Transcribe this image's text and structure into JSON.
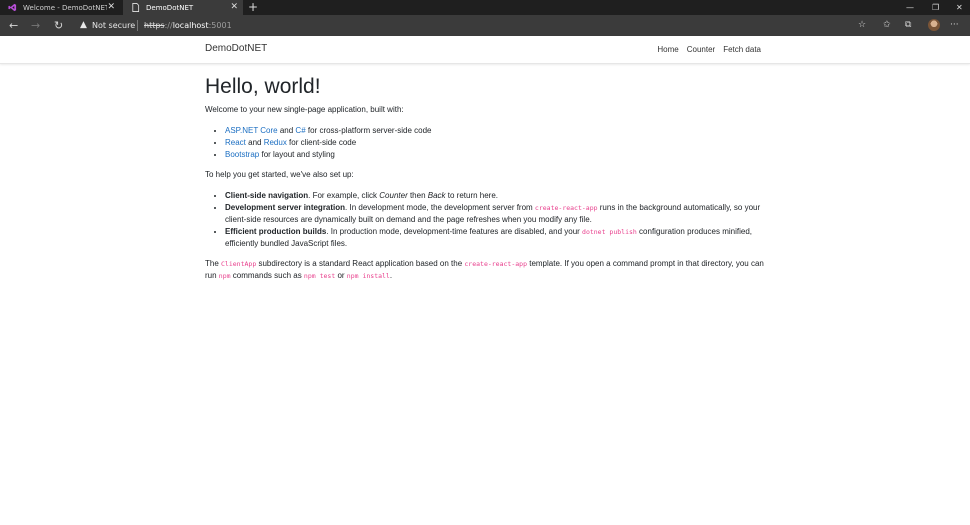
{
  "browser": {
    "tabs": [
      {
        "title": "Welcome - DemoDotNET [Code...",
        "active": false
      },
      {
        "title": "DemoDotNET",
        "active": true
      }
    ],
    "security_text": "Not secure",
    "url_protocol": "https",
    "url_host": "localhost",
    "url_port": ":5001"
  },
  "app": {
    "brand": "DemoDotNET",
    "nav": [
      "Home",
      "Counter",
      "Fetch data"
    ]
  },
  "content": {
    "heading": "Hello, world!",
    "intro": "Welcome to your new single-page application, built with:",
    "built_with": [
      {
        "link1": "ASP.NET Core",
        "mid": " and ",
        "link2": "C#",
        "tail": " for cross-platform server-side code"
      },
      {
        "link1": "React",
        "mid": " and ",
        "link2": "Redux",
        "tail": " for client-side code"
      },
      {
        "link1": "Bootstrap",
        "tail": " for layout and styling"
      }
    ],
    "setup_intro": "To help you get started, we've also set up:",
    "features": [
      {
        "title": "Client-side navigation",
        "t1": ". For example, click ",
        "em1": "Counter",
        "t2": " then ",
        "em2": "Back",
        "t3": " to return here."
      },
      {
        "title": "Development server integration",
        "t1": ". In development mode, the development server from ",
        "code1": "create-react-app",
        "t2": " runs in the background automatically, so your client-side resources are dynamically built on demand and the page refreshes when you modify any file."
      },
      {
        "title": "Efficient production builds",
        "t1": ". In production mode, development-time features are disabled, and your ",
        "code1": "dotnet publish",
        "t2": " configuration produces minified, efficiently bundled JavaScript files."
      }
    ],
    "closing": {
      "t1": "The ",
      "code1": "ClientApp",
      "t2": " subdirectory is a standard React application based on the ",
      "code2": "create-react-app",
      "t3": " template. If you open a command prompt in that directory, you can run ",
      "code3": "npm",
      "t4": " commands such as ",
      "code4": "npm test",
      "t5": " or ",
      "code5": "npm install",
      "t6": "."
    }
  }
}
